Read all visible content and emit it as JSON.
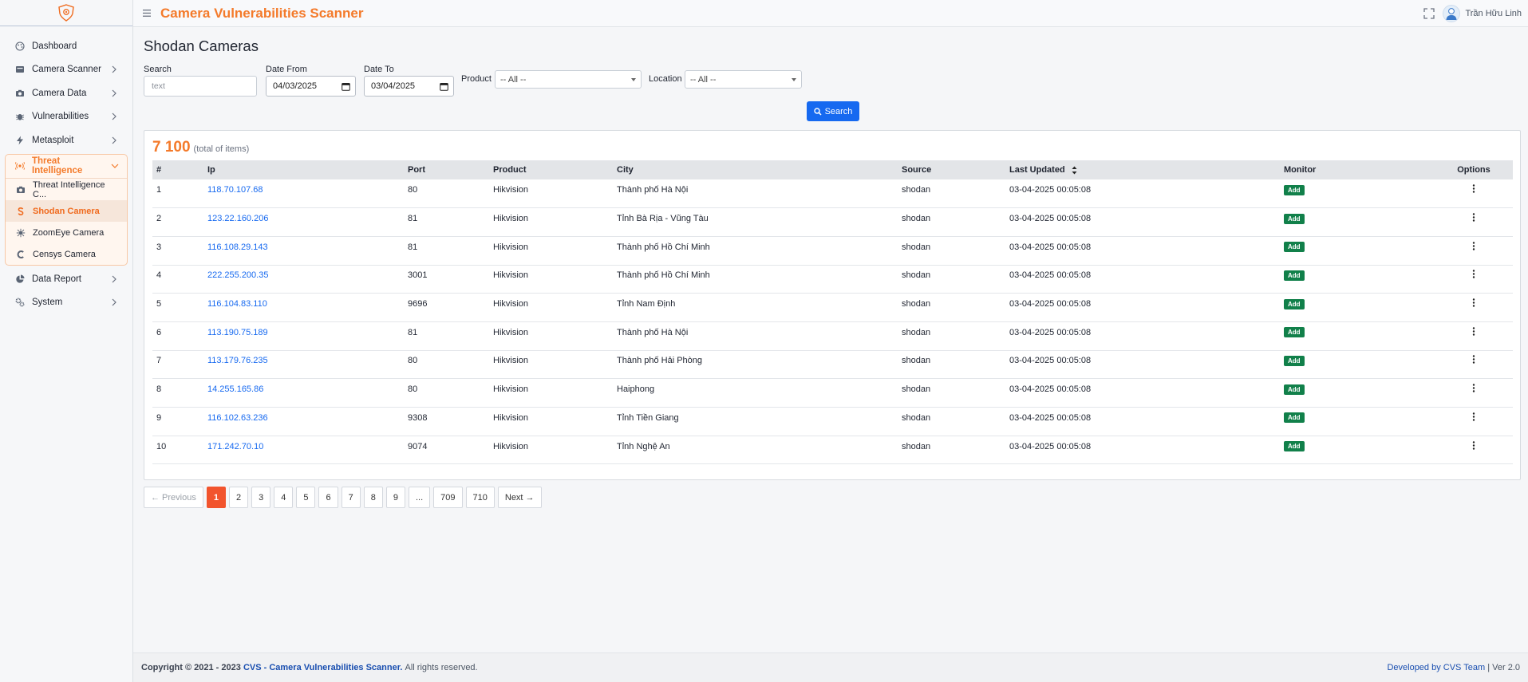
{
  "colors": {
    "accent": "#f47a2a",
    "primary": "#1669f0",
    "success": "#11804a",
    "page_active": "#f2542d"
  },
  "header": {
    "app_title": "Camera Vulnerabilities Scanner",
    "user_name": "Trần Hữu Linh"
  },
  "sidebar": {
    "items": [
      {
        "label": "Dashboard",
        "icon": "palette-icon"
      },
      {
        "label": "Camera Scanner",
        "icon": "scanner-icon"
      },
      {
        "label": "Camera Data",
        "icon": "camera-icon"
      },
      {
        "label": "Vulnerabilities",
        "icon": "bug-icon"
      },
      {
        "label": "Metasploit",
        "icon": "bolt-icon"
      }
    ],
    "group": {
      "label": "Threat Intelligence",
      "icon": "radar-icon",
      "children": [
        {
          "label": "Threat Intelligence C...",
          "icon": "camera-icon"
        },
        {
          "label": "Shodan Camera",
          "icon": "dollar-icon"
        },
        {
          "label": "ZoomEye Camera",
          "icon": "spider-icon"
        },
        {
          "label": "Censys Camera",
          "icon": "c-icon"
        }
      ]
    },
    "after": [
      {
        "label": "Data Report",
        "icon": "pie-chart-icon"
      },
      {
        "label": "System",
        "icon": "gears-icon"
      }
    ]
  },
  "page": {
    "title": "Shodan Cameras",
    "filters": {
      "search_label": "Search",
      "search_placeholder": "text",
      "date_from_label": "Date From",
      "date_from_value": "04/03/2025",
      "date_to_label": "Date To",
      "date_to_value": "03/04/2025",
      "product_label": "Product",
      "product_value": "-- All --",
      "location_label": "Location",
      "location_value": "-- All --",
      "search_button": "Search"
    },
    "total": {
      "count": "7 100",
      "suffix": "(total of items)"
    },
    "table": {
      "headers": [
        "#",
        "Ip",
        "Port",
        "Product",
        "City",
        "Source",
        "Last Updated",
        "Monitor",
        "Options"
      ],
      "add_label": "Add",
      "rows": [
        {
          "n": "1",
          "ip": "118.70.107.68",
          "port": "80",
          "product": "Hikvision",
          "city": "Thành phố Hà Nội",
          "source": "shodan",
          "updated": "03-04-2025 00:05:08"
        },
        {
          "n": "2",
          "ip": "123.22.160.206",
          "port": "81",
          "product": "Hikvision",
          "city": "Tỉnh Bà Rịa - Vũng Tàu",
          "source": "shodan",
          "updated": "03-04-2025 00:05:08"
        },
        {
          "n": "3",
          "ip": "116.108.29.143",
          "port": "81",
          "product": "Hikvision",
          "city": "Thành phố Hồ Chí Minh",
          "source": "shodan",
          "updated": "03-04-2025 00:05:08"
        },
        {
          "n": "4",
          "ip": "222.255.200.35",
          "port": "3001",
          "product": "Hikvision",
          "city": "Thành phố Hồ Chí Minh",
          "source": "shodan",
          "updated": "03-04-2025 00:05:08"
        },
        {
          "n": "5",
          "ip": "116.104.83.110",
          "port": "9696",
          "product": "Hikvision",
          "city": "Tỉnh Nam Định",
          "source": "shodan",
          "updated": "03-04-2025 00:05:08"
        },
        {
          "n": "6",
          "ip": "113.190.75.189",
          "port": "81",
          "product": "Hikvision",
          "city": "Thành phố Hà Nội",
          "source": "shodan",
          "updated": "03-04-2025 00:05:08"
        },
        {
          "n": "7",
          "ip": "113.179.76.235",
          "port": "80",
          "product": "Hikvision",
          "city": "Thành phố Hải Phòng",
          "source": "shodan",
          "updated": "03-04-2025 00:05:08"
        },
        {
          "n": "8",
          "ip": "14.255.165.86",
          "port": "80",
          "product": "Hikvision",
          "city": "Haiphong",
          "source": "shodan",
          "updated": "03-04-2025 00:05:08"
        },
        {
          "n": "9",
          "ip": "116.102.63.236",
          "port": "9308",
          "product": "Hikvision",
          "city": "Tỉnh Tiền Giang",
          "source": "shodan",
          "updated": "03-04-2025 00:05:08"
        },
        {
          "n": "10",
          "ip": "171.242.70.10",
          "port": "9074",
          "product": "Hikvision",
          "city": "Tỉnh Nghệ An",
          "source": "shodan",
          "updated": "03-04-2025 00:05:08"
        }
      ]
    },
    "pagination": {
      "previous": "← Previous",
      "next": "Next →",
      "pages": [
        "1",
        "2",
        "3",
        "4",
        "5",
        "6",
        "7",
        "8",
        "9",
        "...",
        "709",
        "710"
      ],
      "active": "1"
    }
  },
  "footer": {
    "copyright": "Copyright © 2021 - 2023",
    "brand": "CVS - Camera Vulnerabilities Scanner.",
    "rights": "All rights reserved.",
    "developed": "Developed by CVS Team",
    "version": "| Ver 2.0"
  }
}
